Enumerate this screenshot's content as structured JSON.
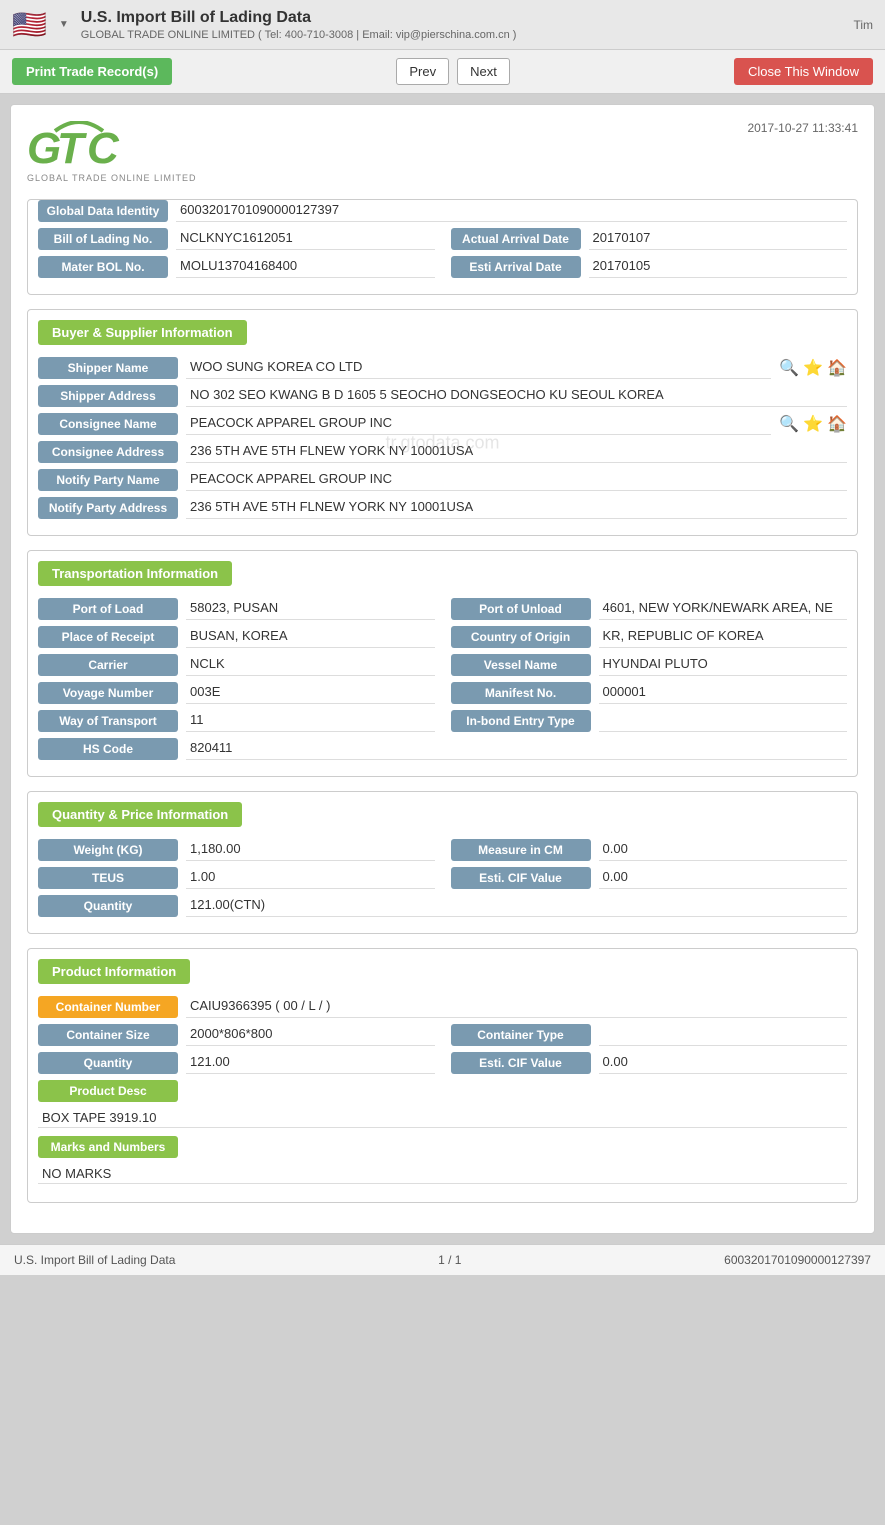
{
  "topbar": {
    "title": "U.S. Import Bill of Lading Data",
    "subtitle": "GLOBAL TRADE ONLINE LIMITED ( Tel: 400-710-3008 | Email: vip@pierschina.com.cn )",
    "time": "Tim"
  },
  "toolbar": {
    "print_label": "Print Trade Record(s)",
    "prev_label": "Prev",
    "next_label": "Next",
    "close_label": "Close This Window"
  },
  "doc": {
    "logo_sub": "GLOBAL TRADE ONLINE LIMITED",
    "date": "2017-10-27 11:33:41",
    "global_data_identity_label": "Global Data Identity",
    "global_data_identity_value": "6003201701090000127397",
    "bol_label": "Bill of Lading No.",
    "bol_value": "NCLKNYC1612051",
    "actual_arrival_label": "Actual Arrival Date",
    "actual_arrival_value": "20170107",
    "master_bol_label": "Mater BOL No.",
    "master_bol_value": "MOLU13704168400",
    "esti_arrival_label": "Esti Arrival Date",
    "esti_arrival_value": "20170105"
  },
  "buyer_supplier": {
    "section_title": "Buyer & Supplier Information",
    "shipper_name_label": "Shipper Name",
    "shipper_name_value": "WOO SUNG KOREA CO LTD",
    "shipper_address_label": "Shipper Address",
    "shipper_address_value": "NO 302 SEO KWANG B D 1605 5 SEOCHO DONGSEOCHO KU SEOUL KOREA",
    "consignee_name_label": "Consignee Name",
    "consignee_name_value": "PEACOCK APPAREL GROUP INC",
    "consignee_address_label": "Consignee Address",
    "consignee_address_value": "236 5TH AVE 5TH FLNEW YORK NY 10001USA",
    "notify_party_name_label": "Notify Party Name",
    "notify_party_name_value": "PEACOCK APPAREL GROUP INC",
    "notify_party_address_label": "Notify Party Address",
    "notify_party_address_value": "236 5TH AVE 5TH FLNEW YORK NY 10001USA"
  },
  "transportation": {
    "section_title": "Transportation Information",
    "port_of_load_label": "Port of Load",
    "port_of_load_value": "58023, PUSAN",
    "port_of_unload_label": "Port of Unload",
    "port_of_unload_value": "4601, NEW YORK/NEWARK AREA, NE",
    "place_of_receipt_label": "Place of Receipt",
    "place_of_receipt_value": "BUSAN, KOREA",
    "country_of_origin_label": "Country of Origin",
    "country_of_origin_value": "KR, REPUBLIC OF KOREA",
    "carrier_label": "Carrier",
    "carrier_value": "NCLK",
    "vessel_name_label": "Vessel Name",
    "vessel_name_value": "HYUNDAI PLUTO",
    "voyage_number_label": "Voyage Number",
    "voyage_number_value": "003E",
    "manifest_no_label": "Manifest No.",
    "manifest_no_value": "000001",
    "way_of_transport_label": "Way of Transport",
    "way_of_transport_value": "11",
    "inbond_entry_label": "In-bond Entry Type",
    "inbond_entry_value": "",
    "hs_code_label": "HS Code",
    "hs_code_value": "820411"
  },
  "quantity_price": {
    "section_title": "Quantity & Price Information",
    "weight_label": "Weight (KG)",
    "weight_value": "1,180.00",
    "measure_label": "Measure in CM",
    "measure_value": "0.00",
    "teus_label": "TEUS",
    "teus_value": "1.00",
    "esti_cif_label": "Esti. CIF Value",
    "esti_cif_value": "0.00",
    "quantity_label": "Quantity",
    "quantity_value": "121.00(CTN)"
  },
  "product": {
    "section_title": "Product Information",
    "container_number_label": "Container Number",
    "container_number_value": "CAIU9366395 ( 00 / L / )",
    "container_size_label": "Container Size",
    "container_size_value": "2000*806*800",
    "container_type_label": "Container Type",
    "container_type_value": "",
    "quantity_label": "Quantity",
    "quantity_value": "121.00",
    "esti_cif_label": "Esti. CIF Value",
    "esti_cif_value": "0.00",
    "product_desc_label": "Product Desc",
    "product_desc_value": "BOX TAPE 3919.10",
    "marks_numbers_label": "Marks and Numbers",
    "marks_numbers_value": "NO MARKS"
  },
  "footer": {
    "left": "U.S. Import Bill of Lading Data",
    "middle": "1 / 1",
    "right": "6003201701090000127397"
  },
  "watermark": "tr.gtodata.com"
}
